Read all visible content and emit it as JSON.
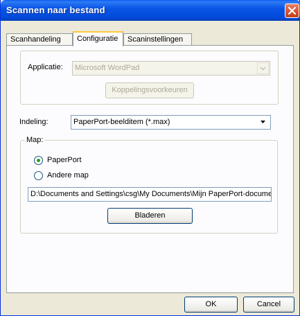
{
  "window": {
    "title": "Scannen naar bestand"
  },
  "tabs": [
    {
      "label": "Scanhandeling",
      "active": false
    },
    {
      "label": "Configuratie",
      "active": true
    },
    {
      "label": "Scaninstellingen",
      "active": false
    }
  ],
  "applicatie": {
    "label": "Applicatie:",
    "value": "Microsoft WordPad",
    "enabled": false,
    "koppeling_button": "Koppelingsvoorkeuren"
  },
  "indeling": {
    "label": "Indeling:",
    "value": "PaperPort-beelditem (*.max)"
  },
  "map": {
    "legend": "Map:",
    "options": [
      {
        "label": "PaperPort",
        "selected": true
      },
      {
        "label": "Andere map",
        "selected": false
      }
    ],
    "path": "D:\\Documents and Settings\\csg\\My Documents\\Mijn PaperPort-documenten",
    "browse_button": "Bladeren"
  },
  "footer": {
    "ok": "OK",
    "cancel": "Cancel"
  },
  "colors": {
    "titlebar": "#0a55e6",
    "dialog_bg": "#ece9d8",
    "tab_highlight": "#ffc83c",
    "close_button": "#d4502e"
  }
}
